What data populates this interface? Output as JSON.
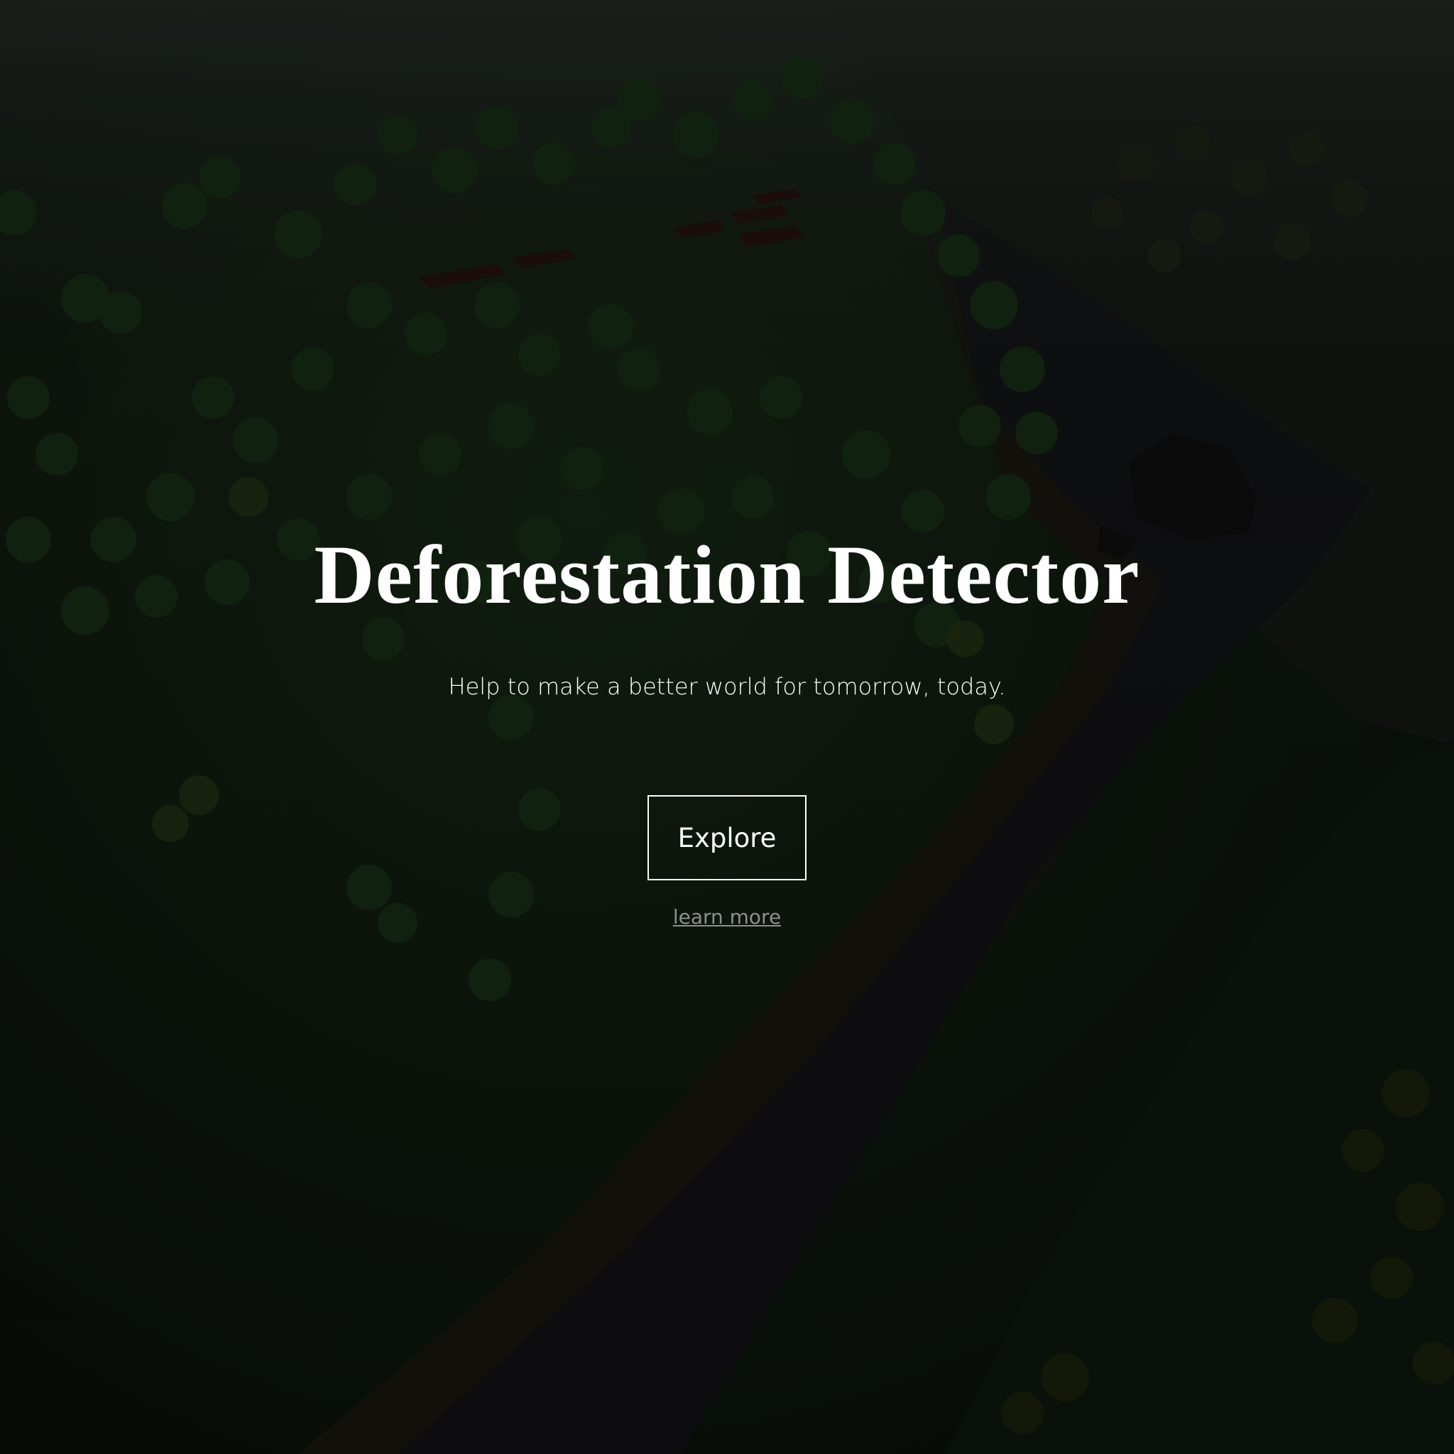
{
  "hero": {
    "title": "Deforestation Detector",
    "subtitle": "Help to make a better world for tomorrow, today.",
    "explore_label": "Explore",
    "learn_more_label": "learn more"
  },
  "colors": {
    "text": "#ffffff",
    "link": "#8e8e8e",
    "forest": "#142414",
    "river": "#15151a",
    "bank": "#1c1a12"
  }
}
